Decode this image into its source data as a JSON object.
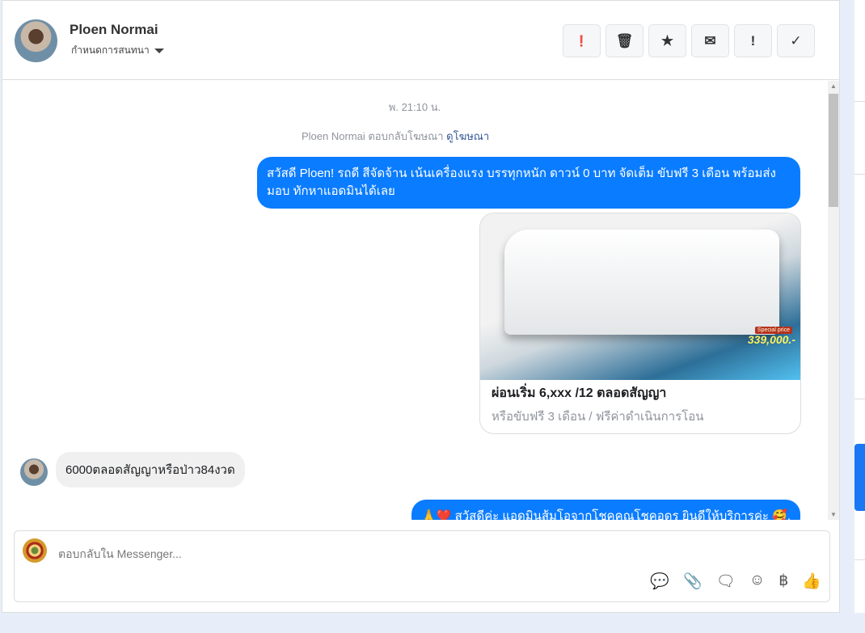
{
  "header": {
    "name": "Ploen Normai",
    "subtitle": "กำหนดการสนทนา",
    "tools": [
      {
        "icon": "alert-circle-icon",
        "glyph": "❗"
      },
      {
        "icon": "trash-icon",
        "glyph": "🗑"
      },
      {
        "icon": "star-icon",
        "glyph": "★"
      },
      {
        "icon": "envelope-icon",
        "glyph": "✉"
      },
      {
        "icon": "exclamation-icon",
        "glyph": "!"
      },
      {
        "icon": "check-icon",
        "glyph": "✓"
      }
    ]
  },
  "thread": {
    "timestamp": "พ. 21:10 น.",
    "reply_note": "Ploen Normai ตอบกลับโฆษณา",
    "reply_link": "ดูโฆษณา",
    "msg1": "สวัสดี Ploen! รถดี สีจัดจ้าน เน้นเครื่องแรง บรรทุกหนัก ดาวน์ 0 บาท จัดเต็ม ขับฟรี 3 เดือน พร้อมส่งมอบ ทักหาแอดมินได้เลย",
    "ad": {
      "title": "ผ่อนเริ่ม 6,xxx /12 ตลอดสัญญา",
      "subtitle": "หรือขับฟรี 3 เดือน / ฟรีค่าดำเนินการโอน",
      "badge": "Special price",
      "price": "339,000.-"
    },
    "msg_in": "6000ตลอดสัญญาหรือป่าว84งวด",
    "msg2": "🙏❤️ สวัสดีค่ะ แอดมินส้มโอจากโชคคูณโชคอุดร ยินดีให้บริการค่ะ 🥰."
  },
  "composer": {
    "placeholder": "ตอบกลับใน Messenger...",
    "icons": [
      {
        "icon": "saved-reply-icon",
        "glyph": "💬"
      },
      {
        "icon": "paperclip-icon",
        "glyph": "📎"
      },
      {
        "icon": "chat-dots-icon",
        "glyph": "🗨"
      },
      {
        "icon": "emoji-icon",
        "glyph": "☺"
      },
      {
        "icon": "baht-icon",
        "glyph": "฿"
      },
      {
        "icon": "thumbs-up-icon",
        "glyph": "👍"
      }
    ]
  },
  "colors": {
    "accent": "#0a7cff"
  }
}
